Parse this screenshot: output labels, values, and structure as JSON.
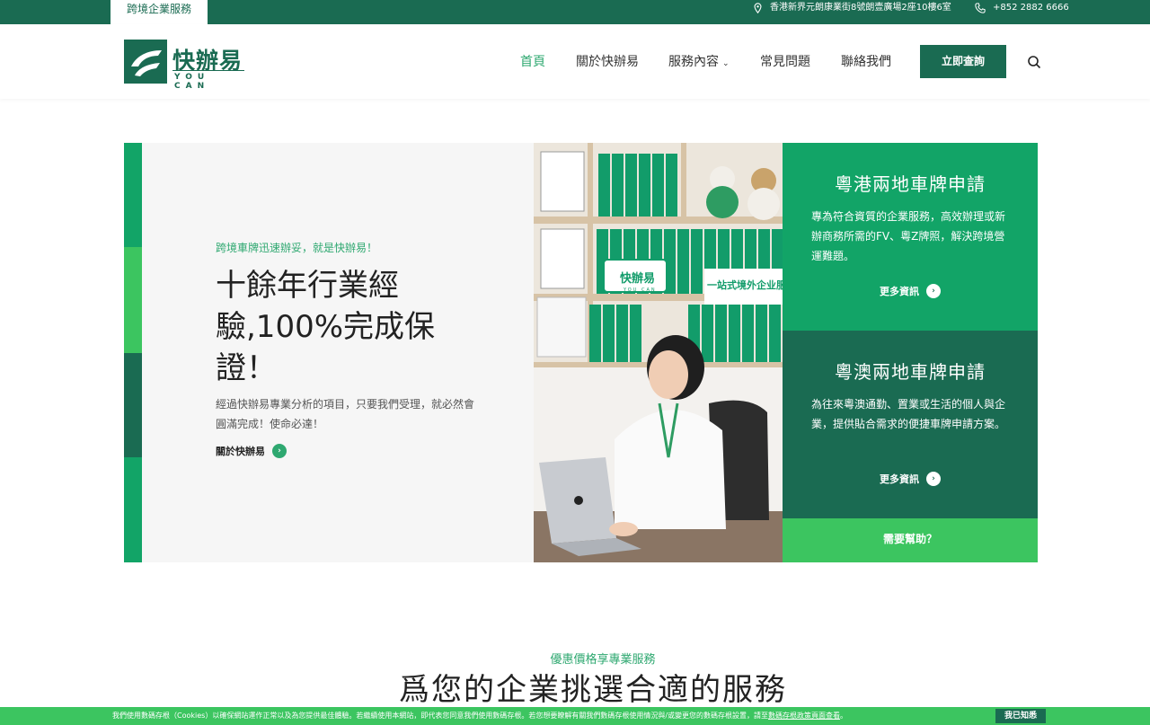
{
  "topbar": {
    "tab_label": "跨境企業服務",
    "address": "香港新界元朗康業街8號朗壹廣場2座10樓6室",
    "phone": "+852 2882 6666",
    "address_icon": "map-pin-icon",
    "phone_icon": "phone-icon"
  },
  "header": {
    "logo_name": "快辦易",
    "logo_sub": "YOU CAN",
    "nav": [
      {
        "label": "首頁",
        "active": true
      },
      {
        "label": "關於快辦易"
      },
      {
        "label": "服務內容",
        "caret": "⌄"
      },
      {
        "label": "常見問題"
      },
      {
        "label": "聯絡我們"
      }
    ],
    "cta_label": "立即查詢",
    "search_icon": "search-icon"
  },
  "hero": {
    "kicker": "跨境車牌迅速辦妥，就是快辦易！",
    "headline": "十餘年行業經驗,100%完成保證！",
    "description": "經過快辦易專業分析的項目，只要我們受理，就必然會圓滿完成！使命必達！",
    "about_link": "關於快辦易",
    "stripe_colors": [
      "#12a467",
      "#3cc560",
      "#1a6b52",
      "#3cc560",
      "#12a467"
    ]
  },
  "cards": [
    {
      "title": "粵港兩地車牌申請",
      "text": "專為符合資質的企業服務，高效辦理或新辦商務所需的FV、粵Z牌照，解決跨境營運難題。",
      "more": "更多資訊",
      "color": "#12a467"
    },
    {
      "title": "粵澳兩地車牌申請",
      "text": "為往來粵澳通勤、置業或生活的個人與企業，提供貼合需求的便捷車牌申請方案。",
      "more": "更多資訊",
      "color": "#1a6b52"
    }
  ],
  "help_label": "需要幫助？",
  "photo": {
    "poster_logo": "快辦易",
    "poster_logo_sub": "YOU CAN",
    "poster_text": "一站式境外企业服务"
  },
  "section": {
    "kicker": "優惠價格享專業服務",
    "title": "爲您的企業挑選合適的服務"
  },
  "cookie": {
    "message": "我們使用數碼存根（Cookies）以確保網站運作正常以及為您提供最佳體驗。若繼續使用本網站，即代表您同意我們使用數碼存根。若您想要瞭解有關我們數碼存根使用情況與/或變更您的數碼存根設置，請至",
    "link": "數碼存根政策頁面查看",
    "suffix": "。",
    "ok_label": "我已知悉"
  },
  "colors": {
    "brand_dark": "#1a6b52",
    "brand_green": "#12a467",
    "accent_green": "#3cc560",
    "link_green": "#2ea870"
  }
}
